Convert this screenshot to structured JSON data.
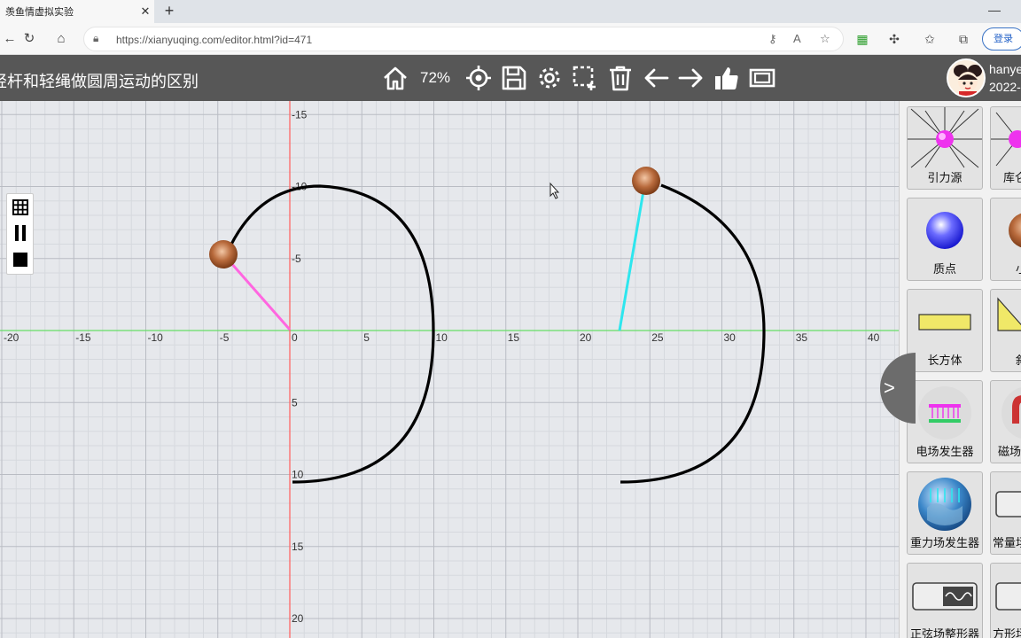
{
  "browser": {
    "tab_title": "羡鱼情虚拟实验",
    "tab_close": "✕",
    "new_tab": "+",
    "minimize": "—",
    "url": "https://xianyuqing.com/editor.html?id=471",
    "login": "登录"
  },
  "header": {
    "title": "轻杆和轻绳做圆周运动的区别",
    "zoom": "72%",
    "user_name": "hanye",
    "user_date": "2022-"
  },
  "axes": {
    "x_ticks": [
      "-20",
      "-15",
      "-10",
      "-5",
      "0",
      "5",
      "10",
      "15",
      "20",
      "25",
      "30",
      "35",
      "40"
    ],
    "y_ticks_top": [
      "-15",
      "-10",
      "-5"
    ],
    "y_ticks_bottom": [
      "5",
      "10",
      "15",
      "20"
    ]
  },
  "panel": {
    "items": [
      {
        "label": "引力源",
        "icon": "gravity-source-icon"
      },
      {
        "label": "库仑",
        "icon": "coulomb-source-icon"
      },
      {
        "label": "质点",
        "icon": "particle-icon"
      },
      {
        "label": "小",
        "icon": "small-ball-icon"
      },
      {
        "label": "长方体",
        "icon": "cuboid-icon"
      },
      {
        "label": "斜",
        "icon": "incline-icon"
      },
      {
        "label": "电场发生器",
        "icon": "electric-field-generator-icon"
      },
      {
        "label": "磁场",
        "icon": "magnetic-field-icon"
      },
      {
        "label": "重力场发生器",
        "icon": "gravity-field-generator-icon"
      },
      {
        "label": "常量场",
        "icon": "constant-field-icon"
      },
      {
        "label": "正弦场整形器",
        "icon": "sine-field-shaper-icon"
      },
      {
        "label": "方形场",
        "icon": "square-field-icon"
      }
    ],
    "collapse_label": ">"
  },
  "colors": {
    "rod": "#ff66e0",
    "rope": "#2de6ee",
    "ball": "#b86a3c",
    "x_axis": "#66dd66",
    "y_axis": "#ff6666"
  }
}
